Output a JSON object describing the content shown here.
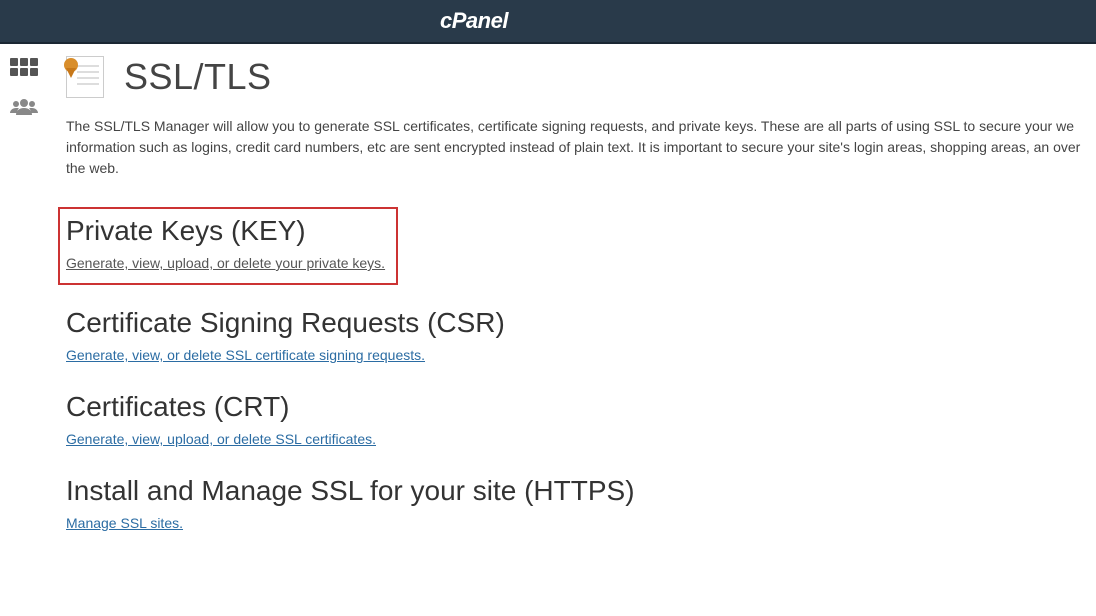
{
  "header": {
    "logo": "cPanel"
  },
  "page": {
    "title": "SSL/TLS",
    "intro": "The SSL/TLS Manager will allow you to generate SSL certificates, certificate signing requests, and private keys. These are all parts of using SSL to secure your we information such as logins, credit card numbers, etc are sent encrypted instead of plain text. It is important to secure your site's login areas, shopping areas, an over the web."
  },
  "sections": {
    "privateKeys": {
      "title": "Private Keys (KEY)",
      "link": "Generate, view, upload, or delete your private keys."
    },
    "csr": {
      "title": "Certificate Signing Requests (CSR)",
      "link": "Generate, view, or delete SSL certificate signing requests."
    },
    "crt": {
      "title": "Certificates (CRT)",
      "link": "Generate, view, upload, or delete SSL certificates."
    },
    "install": {
      "title": "Install and Manage SSL for your site (HTTPS)",
      "link": "Manage SSL sites."
    }
  }
}
